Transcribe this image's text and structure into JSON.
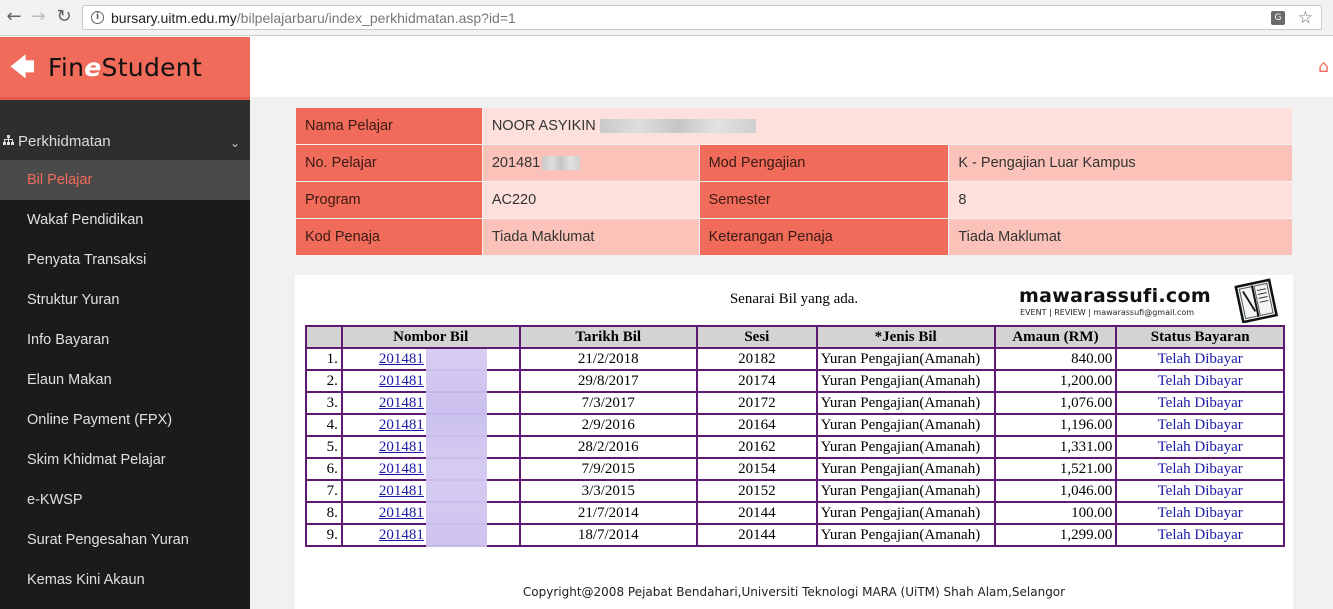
{
  "browser": {
    "url_host": "bursary.uitm.edu.my",
    "url_path": "/bilpelajarbaru/index_perkhidmatan.asp?id=1"
  },
  "sidebar": {
    "logo_prefix": "Fin",
    "logo_e": "e",
    "logo_suffix": "Student",
    "group_label": "Perkhidmatan",
    "items": [
      {
        "label": "Bil Pelajar",
        "active": true
      },
      {
        "label": "Wakaf Pendidikan"
      },
      {
        "label": "Penyata Transaksi"
      },
      {
        "label": "Struktur Yuran"
      },
      {
        "label": "Info Bayaran"
      },
      {
        "label": "Elaun Makan"
      },
      {
        "label": "Online Payment (FPX)"
      },
      {
        "label": "Skim Khidmat Pelajar"
      },
      {
        "label": "e-KWSP"
      },
      {
        "label": "Surat Pengesahan Yuran"
      },
      {
        "label": "Kemas Kini Akaun"
      }
    ]
  },
  "student": {
    "name_label": "Nama Pelajar",
    "name_value": "NOOR ASYIKIN",
    "id_label": "No. Pelajar",
    "id_value": "201481",
    "mode_label": "Mod Pengajian",
    "mode_value": "K - Pengajian Luar Kampus",
    "program_label": "Program",
    "program_value": "AC220",
    "semester_label": "Semester",
    "semester_value": "8",
    "sponsor_code_label": "Kod Penaja",
    "sponsor_code_value": "Tiada Maklumat",
    "sponsor_desc_label": "Keterangan Penaja",
    "sponsor_desc_value": "Tiada Maklumat"
  },
  "bills": {
    "caption": "Senarai Bil yang ada.",
    "headers": [
      "",
      "Nombor Bil",
      "Tarikh Bil",
      "Sesi",
      "*Jenis Bil",
      "Amaun (RM)",
      "Status Bayaran"
    ],
    "rows": [
      {
        "no": "1.",
        "bill": "201481",
        "date": "21/2/2018",
        "session": "20182",
        "type": "Yuran Pengajian(Amanah)",
        "amount": "840.00",
        "status": "Telah Dibayar"
      },
      {
        "no": "2.",
        "bill": "201481",
        "date": "29/8/2017",
        "session": "20174",
        "type": "Yuran Pengajian(Amanah)",
        "amount": "1,200.00",
        "status": "Telah Dibayar"
      },
      {
        "no": "3.",
        "bill": "201481",
        "date": "7/3/2017",
        "session": "20172",
        "type": "Yuran Pengajian(Amanah)",
        "amount": "1,076.00",
        "status": "Telah Dibayar"
      },
      {
        "no": "4.",
        "bill": "201481",
        "date": "2/9/2016",
        "session": "20164",
        "type": "Yuran Pengajian(Amanah)",
        "amount": "1,196.00",
        "status": "Telah Dibayar"
      },
      {
        "no": "5.",
        "bill": "201481",
        "date": "28/2/2016",
        "session": "20162",
        "type": "Yuran Pengajian(Amanah)",
        "amount": "1,331.00",
        "status": "Telah Dibayar"
      },
      {
        "no": "6.",
        "bill": "201481",
        "date": "7/9/2015",
        "session": "20154",
        "type": "Yuran Pengajian(Amanah)",
        "amount": "1,521.00",
        "status": "Telah Dibayar"
      },
      {
        "no": "7.",
        "bill": "201481",
        "date": "3/3/2015",
        "session": "20152",
        "type": "Yuran Pengajian(Amanah)",
        "amount": "1,046.00",
        "status": "Telah Dibayar"
      },
      {
        "no": "8.",
        "bill": "201481",
        "date": "21/7/2014",
        "session": "20144",
        "type": "Yuran Pengajian(Amanah)",
        "amount": "100.00",
        "status": "Telah Dibayar"
      },
      {
        "no": "9.",
        "bill": "201481",
        "date": "18/7/2014",
        "session": "20144",
        "type": "Yuran Pengajian(Amanah)",
        "amount": "1,299.00",
        "status": "Telah Dibayar"
      }
    ]
  },
  "watermark": {
    "title": "mawarassufi.com",
    "subtitle": "EVENT | REVIEW | mawarassufi@gmail.com"
  },
  "footer": {
    "copyright": "Copyright@2008 Pejabat Bendahari,Universiti Teknologi MARA (UiTM) Shah Alam,Selangor"
  },
  "colors": {
    "accent": "#f16b5a",
    "sidebar_bg": "#1b1b1b",
    "table_border": "#5e1a73",
    "link": "#1a1aa6"
  }
}
